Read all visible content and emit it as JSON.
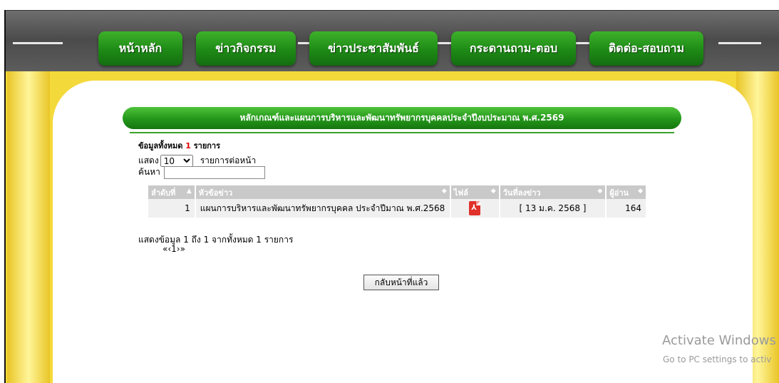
{
  "nav": {
    "items": [
      {
        "label": "หน้าหลัก"
      },
      {
        "label": "ข่าวกิจกรรม"
      },
      {
        "label": "ข่าวประชาสัมพันธ์"
      },
      {
        "label": "กระดานถาม-ตอบ"
      },
      {
        "label": "ติดต่อ-สอบถาม"
      }
    ]
  },
  "page": {
    "title": "หลักเกณฑ์และแผนการบริหารและพัฒนาทรัพยากรบุคคลประจำปีงบประมาณ พ.ศ.2569",
    "total_prefix": "ข้อมูลทั้งหมด",
    "total_count": "1",
    "total_suffix": "รายการ",
    "show_label": "แสดง",
    "page_length": "10",
    "per_page_label": "รายการต่อหน้า",
    "search_label": "ค้นหา",
    "search_value": ""
  },
  "table": {
    "headers": [
      "ลำดับที่",
      "หัวข้อข่าว",
      "ไฟล์",
      "วันที่ลงข่าว",
      "ผู้อ่าน"
    ],
    "rows": [
      {
        "no": "1",
        "title": "แผนการบริหารและพัฒนาทรัพยากรบุคคล ประจำปีมาณ พ.ศ.2568",
        "file_icon": "pdf-icon",
        "date": "[ 13 ม.ค. 2568 ]",
        "views": "164"
      }
    ]
  },
  "footer": {
    "info": "แสดงข้อมูล 1 ถึง 1 จากทั้งหมด 1 รายการ",
    "pagination": "«‹1›»",
    "back_label": "กลับหน้าที่แล้ว"
  },
  "watermark": {
    "line1": "Activate Windows",
    "line2": "Go to PC settings to activ"
  },
  "colors": {
    "nav_green": "#1e8a16",
    "band_yellow": "#f4d93b",
    "header_gray": "#c9c9c9"
  }
}
